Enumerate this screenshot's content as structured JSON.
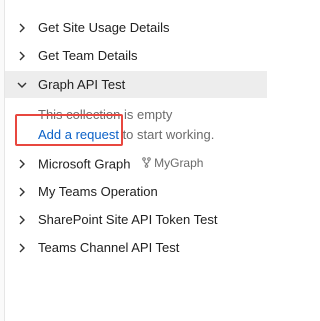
{
  "collections": {
    "items": [
      {
        "label": "Get Site Usage Details",
        "expanded": false
      },
      {
        "label": "Get Team Details",
        "expanded": false
      },
      {
        "label": "Graph API Test",
        "expanded": true
      },
      {
        "label": "Microsoft Graph",
        "expanded": false,
        "fork_label": "MyGraph"
      },
      {
        "label": "My Teams Operation",
        "expanded": false
      },
      {
        "label": "SharePoint Site API Token Test",
        "expanded": false
      },
      {
        "label": "Teams Channel API Test",
        "expanded": false
      }
    ],
    "empty_state": {
      "message": "This collection is empty",
      "link_text": "Add a request",
      "suffix": " to start working."
    }
  },
  "colors": {
    "selected_bg": "#ededed",
    "link": "#0b61c7",
    "highlight_border": "#e8473f"
  },
  "icons": {
    "collapsed": "chevron-right-icon",
    "expanded": "chevron-down-icon",
    "fork": "fork-icon"
  }
}
